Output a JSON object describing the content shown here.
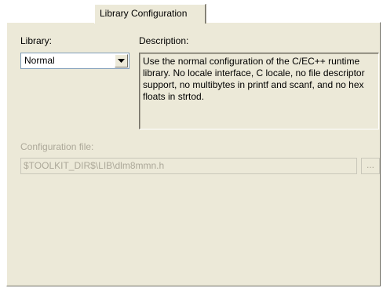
{
  "tab": {
    "label": "Library Configuration"
  },
  "library": {
    "label": "Library:",
    "selected": "Normal"
  },
  "description": {
    "label": "Description:",
    "text": "Use the normal configuration of the C/EC++ runtime library. No locale interface, C locale, no file descriptor support, no multibytes in printf and scanf, and no hex floats in strtod."
  },
  "config_file": {
    "label": "Configuration file:",
    "value": "$TOOLKIT_DIR$\\LIB\\dlm8mmn.h",
    "browse_label": "..."
  }
}
